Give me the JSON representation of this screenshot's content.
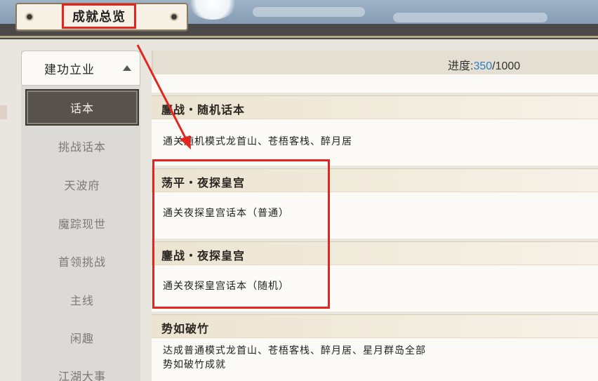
{
  "header": {
    "title": "成就总览"
  },
  "nav": {
    "category": "建功立业",
    "items": [
      {
        "label": "话本",
        "active": true
      },
      {
        "label": "挑战话本",
        "active": false
      },
      {
        "label": "天波府",
        "active": false
      },
      {
        "label": "魔踪现世",
        "active": false
      },
      {
        "label": "首领挑战",
        "active": false
      },
      {
        "label": "主线",
        "active": false
      },
      {
        "label": "闲趣",
        "active": false
      },
      {
        "label": "江湖大事",
        "active": false
      }
    ]
  },
  "progress": {
    "label": "进度:",
    "current": "350",
    "total": "/1000"
  },
  "achievements": [
    {
      "title": "鏖战・随机话本",
      "desc": "通关随机模式龙首山、苍梧客栈、醉月居"
    },
    {
      "title": "荡平・夜探皇宫",
      "desc": "通关夜探皇宫话本（普通）"
    },
    {
      "title": "鏖战・夜探皇宫",
      "desc": "通关夜探皇宫话本（随机）"
    },
    {
      "title": "势如破竹",
      "desc": "达成普通模式龙首山、苍梧客栈、醉月居、星月群岛全部\n势如破竹成就"
    }
  ],
  "colors": {
    "accent_red": "#e5231f",
    "progress_current": "#2f7fc6",
    "nav_active_bg": "#57524c"
  }
}
